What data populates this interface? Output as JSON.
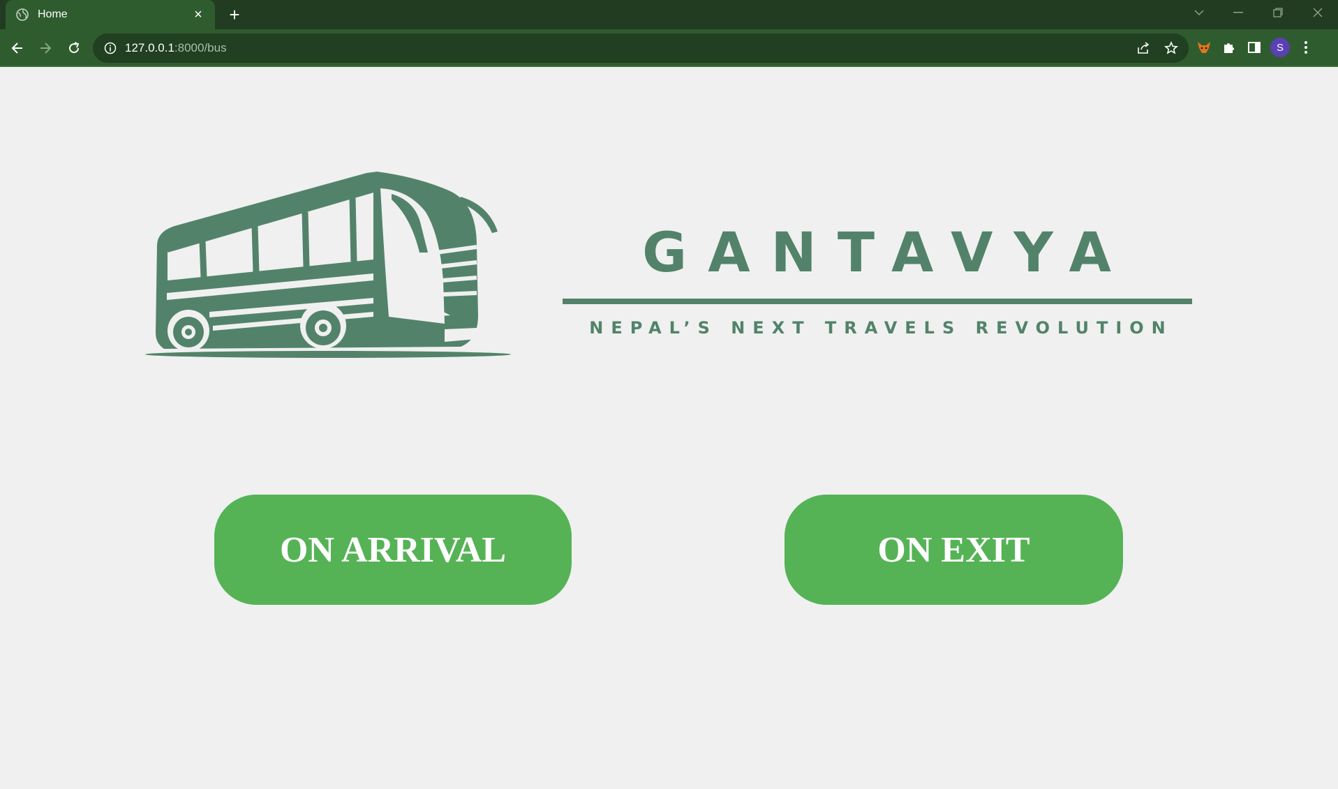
{
  "browser": {
    "tab_title": "Home",
    "new_tab_symbol": "+",
    "close_symbol": "×",
    "url_host": "127.0.0.1",
    "url_rest": ":8000/bus",
    "profile_initial": "S",
    "icons": [
      "globe-icon",
      "back-icon",
      "forward-icon",
      "reload-icon",
      "info-icon",
      "share-icon",
      "star-icon",
      "fox-extension-icon",
      "puzzle-icon",
      "side-panel-icon",
      "menu-dots-icon",
      "tab-search-icon",
      "minimize-icon",
      "restore-icon",
      "close-window-icon"
    ]
  },
  "brand": {
    "name": "GANTAVYA",
    "tagline": "NEPAL’S NEXT TRAVELS REVOLUTION",
    "color": "#52836a"
  },
  "actions": {
    "arrival_label": "ON ARRIVAL",
    "exit_label": "ON EXIT",
    "button_color": "#55b355"
  },
  "colors": {
    "chrome_dark": "#213c21",
    "chrome_tab": "#2f5c2f",
    "page_background": "#f0f0f0"
  }
}
